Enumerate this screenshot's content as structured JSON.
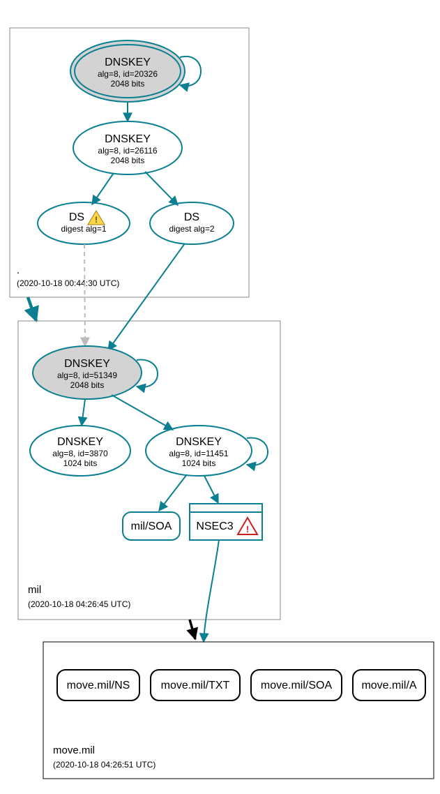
{
  "zones": {
    "root": {
      "label": ".",
      "timestamp": "(2020-10-18 00:44:30 UTC)"
    },
    "mil": {
      "label": "mil",
      "timestamp": "(2020-10-18 04:26:45 UTC)"
    },
    "move": {
      "label": "move.mil",
      "timestamp": "(2020-10-18 04:26:51 UTC)"
    }
  },
  "nodes": {
    "root_ksk": {
      "title": "DNSKEY",
      "line1": "alg=8, id=20326",
      "line2": "2048 bits"
    },
    "root_zsk": {
      "title": "DNSKEY",
      "line1": "alg=8, id=26116",
      "line2": "2048 bits"
    },
    "ds1": {
      "title": "DS",
      "line1": "digest alg=1"
    },
    "ds2": {
      "title": "DS",
      "line1": "digest alg=2"
    },
    "mil_ksk": {
      "title": "DNSKEY",
      "line1": "alg=8, id=51349",
      "line2": "2048 bits"
    },
    "mil_zsk1": {
      "title": "DNSKEY",
      "line1": "alg=8, id=3870",
      "line2": "1024 bits"
    },
    "mil_zsk2": {
      "title": "DNSKEY",
      "line1": "alg=8, id=11451",
      "line2": "1024 bits"
    },
    "mil_soa": {
      "title": "mil/SOA"
    },
    "nsec3": {
      "title": "NSEC3"
    },
    "move_ns": {
      "title": "move.mil/NS"
    },
    "move_txt": {
      "title": "move.mil/TXT"
    },
    "move_soa": {
      "title": "move.mil/SOA"
    },
    "move_a": {
      "title": "move.mil/A"
    }
  },
  "chart_data": {
    "type": "graph",
    "description": "DNSSEC delegation / signature graph for move.mil",
    "zones": [
      {
        "name": ".",
        "timestamp": "2020-10-18 00:44:30 UTC"
      },
      {
        "name": "mil",
        "timestamp": "2020-10-18 04:26:45 UTC"
      },
      {
        "name": "move.mil",
        "timestamp": "2020-10-18 04:26:51 UTC"
      }
    ],
    "nodes": [
      {
        "id": "root_ksk",
        "zone": ".",
        "type": "DNSKEY",
        "alg": 8,
        "key_id": 20326,
        "bits": 2048,
        "trust_anchor": true
      },
      {
        "id": "root_zsk",
        "zone": ".",
        "type": "DNSKEY",
        "alg": 8,
        "key_id": 26116,
        "bits": 2048
      },
      {
        "id": "ds1",
        "zone": ".",
        "type": "DS",
        "digest_alg": 1,
        "status": "warning"
      },
      {
        "id": "ds2",
        "zone": ".",
        "type": "DS",
        "digest_alg": 2
      },
      {
        "id": "mil_ksk",
        "zone": "mil",
        "type": "DNSKEY",
        "alg": 8,
        "key_id": 51349,
        "bits": 2048,
        "sep": true
      },
      {
        "id": "mil_zsk1",
        "zone": "mil",
        "type": "DNSKEY",
        "alg": 8,
        "key_id": 3870,
        "bits": 1024
      },
      {
        "id": "mil_zsk2",
        "zone": "mil",
        "type": "DNSKEY",
        "alg": 8,
        "key_id": 11451,
        "bits": 1024
      },
      {
        "id": "mil_soa",
        "zone": "mil",
        "type": "SOA",
        "name": "mil/SOA"
      },
      {
        "id": "nsec3",
        "zone": "mil",
        "type": "NSEC3",
        "status": "error"
      },
      {
        "id": "move_ns",
        "zone": "move.mil",
        "type": "NS",
        "name": "move.mil/NS"
      },
      {
        "id": "move_txt",
        "zone": "move.mil",
        "type": "TXT",
        "name": "move.mil/TXT"
      },
      {
        "id": "move_soa",
        "zone": "move.mil",
        "type": "SOA",
        "name": "move.mil/SOA"
      },
      {
        "id": "move_a",
        "zone": "move.mil",
        "type": "A",
        "name": "move.mil/A"
      }
    ],
    "edges": [
      {
        "from": "root_ksk",
        "to": "root_ksk",
        "kind": "self-sign"
      },
      {
        "from": "root_ksk",
        "to": "root_zsk",
        "kind": "signs"
      },
      {
        "from": "root_zsk",
        "to": "ds1",
        "kind": "signs"
      },
      {
        "from": "root_zsk",
        "to": "ds2",
        "kind": "signs"
      },
      {
        "from": "ds1",
        "to": "mil_ksk",
        "kind": "delegation",
        "status": "insecure"
      },
      {
        "from": "ds2",
        "to": "mil_ksk",
        "kind": "delegation"
      },
      {
        "from": ".",
        "to": "mil",
        "kind": "zone-delegation"
      },
      {
        "from": "mil_ksk",
        "to": "mil_ksk",
        "kind": "self-sign"
      },
      {
        "from": "mil_ksk",
        "to": "mil_zsk1",
        "kind": "signs"
      },
      {
        "from": "mil_ksk",
        "to": "mil_zsk2",
        "kind": "signs"
      },
      {
        "from": "mil_zsk2",
        "to": "mil_zsk2",
        "kind": "self-sign"
      },
      {
        "from": "mil_zsk2",
        "to": "mil_soa",
        "kind": "signs"
      },
      {
        "from": "mil_zsk2",
        "to": "nsec3",
        "kind": "signs"
      },
      {
        "from": "nsec3",
        "to": "move.mil",
        "kind": "covers"
      },
      {
        "from": "mil",
        "to": "move.mil",
        "kind": "zone-delegation"
      }
    ]
  }
}
